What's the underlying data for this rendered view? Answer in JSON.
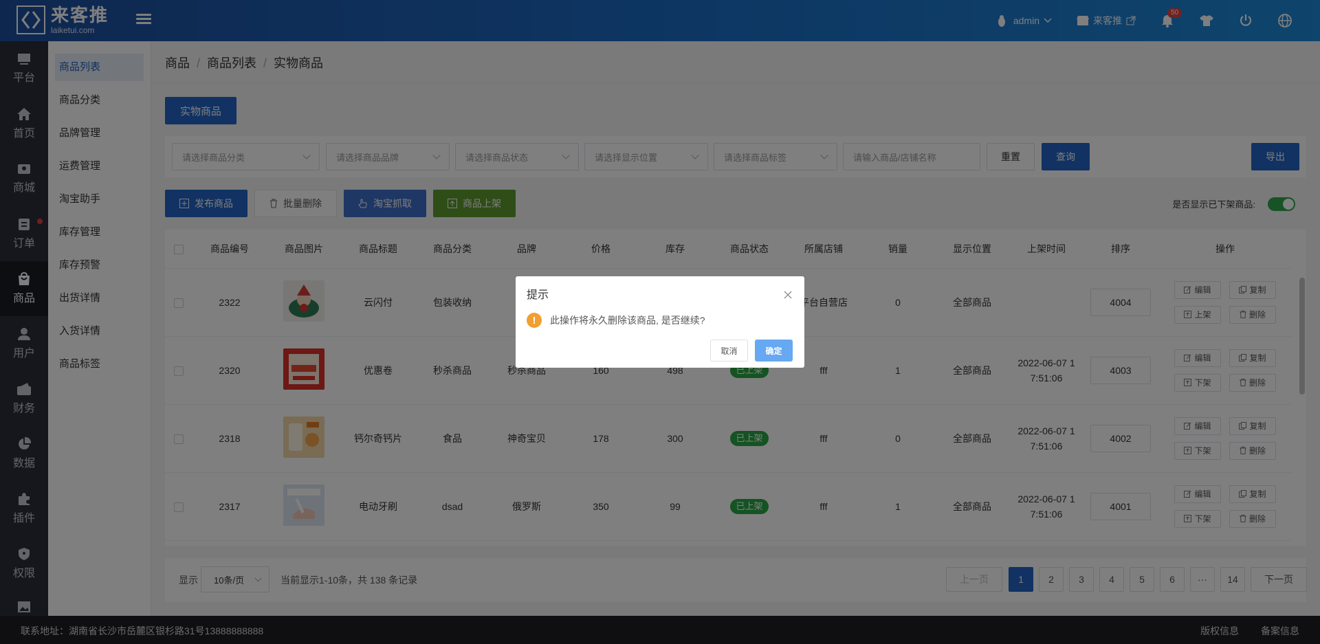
{
  "header": {
    "logo_cn": "来客推",
    "logo_en": "laiketui.com",
    "user": "admin",
    "store": "来客推",
    "notifications": "50"
  },
  "sidebar": [
    {
      "label": "平台",
      "icon": "platform-icon"
    },
    {
      "label": "首页",
      "icon": "home-icon"
    },
    {
      "label": "商城",
      "icon": "mall-icon"
    },
    {
      "label": "订单",
      "icon": "order-icon"
    },
    {
      "label": "商品",
      "icon": "goods-icon"
    },
    {
      "label": "用户",
      "icon": "user-icon"
    },
    {
      "label": "财务",
      "icon": "finance-icon"
    },
    {
      "label": "数据",
      "icon": "data-icon"
    },
    {
      "label": "插件",
      "icon": "plugin-icon"
    },
    {
      "label": "权限",
      "icon": "permission-icon"
    }
  ],
  "subnav": [
    "商品列表",
    "商品分类",
    "品牌管理",
    "运费管理",
    "淘宝助手",
    "库存管理",
    "库存预警",
    "出货详情",
    "入货详情",
    "商品标签"
  ],
  "breadcrumb": [
    "商品",
    "商品列表",
    "实物商品"
  ],
  "tab": "实物商品",
  "filters": {
    "category": "请选择商品分类",
    "brand": "请选择商品品牌",
    "status": "请选择商品状态",
    "position": "请选择显示位置",
    "tag": "请选择商品标签",
    "keyword": "请输入商品/店铺名称",
    "reset": "重置",
    "query": "查询",
    "export": "导出"
  },
  "actions": {
    "publish": "发布商品",
    "batch_delete": "批量删除",
    "taobao": "淘宝抓取",
    "shelve": "商品上架",
    "show_offshelf_label": "是否显示已下架商品:"
  },
  "table": {
    "headers": [
      "商品编号",
      "商品图片",
      "商品标题",
      "商品分类",
      "品牌",
      "价格",
      "库存",
      "商品状态",
      "所属店铺",
      "销量",
      "显示位置",
      "上架时间",
      "排序",
      "操作"
    ],
    "rows": [
      {
        "id": "2322",
        "title": "云闪付",
        "category": "包装收纳",
        "brand": "",
        "price": "",
        "stock": "",
        "status": "",
        "shop": "平台自营店",
        "sales": "0",
        "position": "全部商品",
        "time1": "",
        "time2": "",
        "sort": "4004",
        "op_edit": "编辑",
        "op_copy": "复制",
        "op_toggle": "上架",
        "op_delete": "删除"
      },
      {
        "id": "2320",
        "title": "优惠卷",
        "category": "秒杀商品",
        "brand": "秒杀商品",
        "price": "160",
        "stock": "498",
        "status": "已上架",
        "shop": "fff",
        "sales": "1",
        "position": "全部商品",
        "time1": "2022-06-07 1",
        "time2": "7:51:06",
        "sort": "4003",
        "op_edit": "编辑",
        "op_copy": "复制",
        "op_toggle": "下架",
        "op_delete": "删除"
      },
      {
        "id": "2318",
        "title": "钙尔奇钙片",
        "category": "食品",
        "brand": "神奇宝贝",
        "price": "178",
        "stock": "300",
        "status": "已上架",
        "shop": "fff",
        "sales": "0",
        "position": "全部商品",
        "time1": "2022-06-07 1",
        "time2": "7:51:06",
        "sort": "4002",
        "op_edit": "编辑",
        "op_copy": "复制",
        "op_toggle": "下架",
        "op_delete": "删除"
      },
      {
        "id": "2317",
        "title": "电动牙刷",
        "category": "dsad",
        "brand": "俄罗斯",
        "price": "350",
        "stock": "99",
        "status": "已上架",
        "shop": "fff",
        "sales": "1",
        "position": "全部商品",
        "time1": "2022-06-07 1",
        "time2": "7:51:06",
        "sort": "4001",
        "op_edit": "编辑",
        "op_copy": "复制",
        "op_toggle": "下架",
        "op_delete": "删除"
      }
    ]
  },
  "pager": {
    "show_label": "显示",
    "page_size": "10条/页",
    "summary": "当前显示1-10条，共 138 条记录",
    "prev": "上一页",
    "pages": [
      "1",
      "2",
      "3",
      "4",
      "5",
      "6",
      "···",
      "14"
    ],
    "next": "下一页"
  },
  "footer": {
    "address": "联系地址：湖南省长沙市岳麓区银杉路31号13888888888",
    "copyright": "版权信息",
    "icp": "备案信息"
  },
  "modal": {
    "title": "提示",
    "message": "此操作将永久删除该商品, 是否继续?",
    "cancel": "取消",
    "confirm": "确定"
  }
}
